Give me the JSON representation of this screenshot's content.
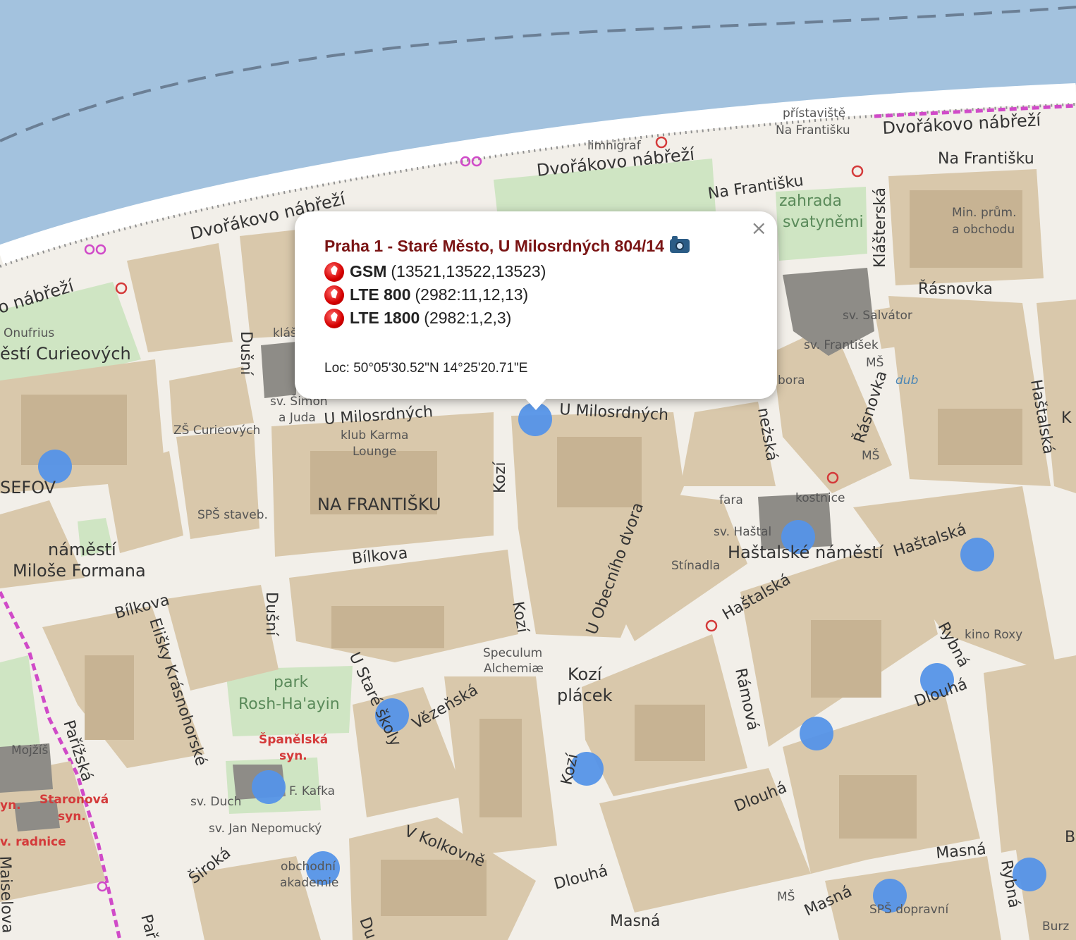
{
  "map": {
    "labels": {
      "pristaviste": "přístaviště",
      "na_frantisku_pier": "Na Františku",
      "dvorakovo_1": "Dvořákovo nábřeží",
      "dvorakovo_2": "Dvořákovo nábřeží",
      "dvorakovo_3": "Dvořákovo nábřeží",
      "dvorakovo_4": "o nábřeží",
      "limnigraf": "limnigraf",
      "na_frantisku_1": "Na Františku",
      "na_frantisku_2": "Na Františku",
      "zahrada": "zahrada",
      "svatynemi": "svatyněmi",
      "min_prum": "Min. prům.",
      "a_obchodu": "a obchodu",
      "klasterska": "Klášterská",
      "rasnovka_1": "Řásnovka",
      "rasnovka_2": "Řásnovka",
      "sv_salvator": "sv. Salvátor",
      "sv_frantisek": "sv. František",
      "ms_1": "MŠ",
      "ms_2": "MŠ",
      "ms_3": "MŠ",
      "bora": "bora",
      "dub": "dub",
      "hastalska_v": "Haštalská",
      "k": "K",
      "onufrius": "Onufrius",
      "namesti_curieovych": "ěstí Curieových",
      "klas": "kláš",
      "dusni_1": "Dušní",
      "dusni_2": "Dušní",
      "sv_simon": "sv. Šimon",
      "a_juda": "a Juda",
      "u_milosrdnych_1": "U Milosrdných",
      "u_milosrdnych_2": "U Milosrdných",
      "zs_curieovych": "ZŠ Curieových",
      "klub_karma": "klub Karma",
      "lounge": "Lounge",
      "kozi_1": "Kozí",
      "kozi_2": "Kozí",
      "kozi_3": "Kozí",
      "snezska": "neżská",
      "josefov": "SEFOV",
      "sps_staveb": "SPŠ staveb.",
      "na_frantisku_district": "NA FRANTIŠKU",
      "fara": "fara",
      "kostnice": "kostnice",
      "sv_hastal": "sv. Haštal",
      "hastalske_namesti": "Haštalské náměstí",
      "hastalska_1": "Haštalská",
      "hastalska_2": "Haštalská",
      "namesti": "náměstí",
      "milose_formana": "Miloše Formana",
      "bilkova_1": "Bílkova",
      "bilkova_2": "Bílkova",
      "u_obecniho_dvora": "U Obecního dvora",
      "stinadla": "Stínadla",
      "elisky": "Elišky Krásnohorské",
      "rybna_1": "Rybná",
      "rybna_2": "Rybná",
      "kino_roxy": "kino Roxy",
      "u_stare_skoly": "U Staré školy",
      "speculum": "Speculum",
      "alchemiae": "Alchemiæ",
      "kozi_placek_1": "Kozí",
      "kozi_placek_2": "plácek",
      "park": "park",
      "rosh": "Rosh-Ha'ayin",
      "vezenska": "Vězeňská",
      "ramova": "Rámová",
      "dlouha_1": "Dlouhá",
      "dlouha_2": "Dlouhá",
      "dlouha_3": "Dlouhá",
      "mojzis": "Mojžíš",
      "parizska": "Pařížská",
      "spanelska": "Španělská",
      "syn_1": "syn.",
      "f_kafka": "F. Kafka",
      "sv_duch": "sv. Duch",
      "staronova": "Staronová",
      "syn_2": "syn.",
      "yn": "yn.",
      "v_radnice": "v. radnice",
      "sv_jan": "sv. Jan Nepomucký",
      "siroka": "Široká",
      "v_kolkovne": "V Kolkovně",
      "obchodni": "obchodní",
      "akademie": "akademie",
      "masna_1": "Masná",
      "masna_2": "Masná",
      "masna_3": "Masná",
      "sps_dopravni": "SPŠ dopravní",
      "maiselova": "Maiselova",
      "parizska_2": "Pař",
      "du": "Du",
      "burz": "Burz",
      "b": "B"
    }
  },
  "popup": {
    "title": "Praha 1 - Staré Město, U Milosrdných 804/14",
    "rows": [
      {
        "tech": "GSM",
        "cells": "(13521,13522,13523)"
      },
      {
        "tech": "LTE 800",
        "cells": "(2982:11,12,13)"
      },
      {
        "tech": "LTE 1800",
        "cells": "(2982:1,2,3)"
      }
    ],
    "location": "Loc: 50°05'30.52\"N 14°25'20.71\"E",
    "close_label": "×"
  },
  "colors": {
    "water": "#a3c2de",
    "block": "#d9c8ab",
    "building": "#cbb898",
    "park": "#cfe5c3",
    "marker": "#5593e8",
    "popup_title": "#7a1414"
  }
}
